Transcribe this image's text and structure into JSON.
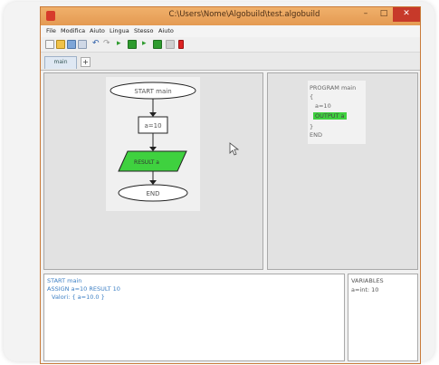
{
  "window": {
    "title": "C:\\Users\\Nome\\Algobuild\\test.algobuild",
    "min_glyph": "–",
    "max_glyph": "□",
    "close_glyph": "✕"
  },
  "menu": [
    "File",
    "Modifica",
    "Aiuto",
    "Lingua",
    "Stesso",
    "Aiuto"
  ],
  "toolbar": {
    "icons": [
      "new-icon",
      "open-icon",
      "save-icon",
      "undo-icon",
      "redo-icon",
      "run-icon",
      "step-icon",
      "run-all-icon",
      "debug-icon",
      "stop-icon"
    ]
  },
  "tabs": {
    "active": "main",
    "add": "+"
  },
  "flowchart": {
    "start": "START main",
    "assign": "a=10",
    "output": "RESULT a",
    "end": "END"
  },
  "code": {
    "l1": "PROGRAM main",
    "l2": "{",
    "l3": "a=10",
    "l4": "OUTPUT a",
    "l5": "}",
    "l6": "END"
  },
  "log": {
    "l1": "START main",
    "l2": "ASSIGN a=10 RESULT 10",
    "l3": "Valori: { a=10.0 }"
  },
  "variables": {
    "header": "VARIABLES",
    "l1": "a=int: 10"
  },
  "colors": {
    "titlebar": "#e49a52",
    "output_fill": "#3fd13f",
    "log_text": "#3c7fc4"
  }
}
